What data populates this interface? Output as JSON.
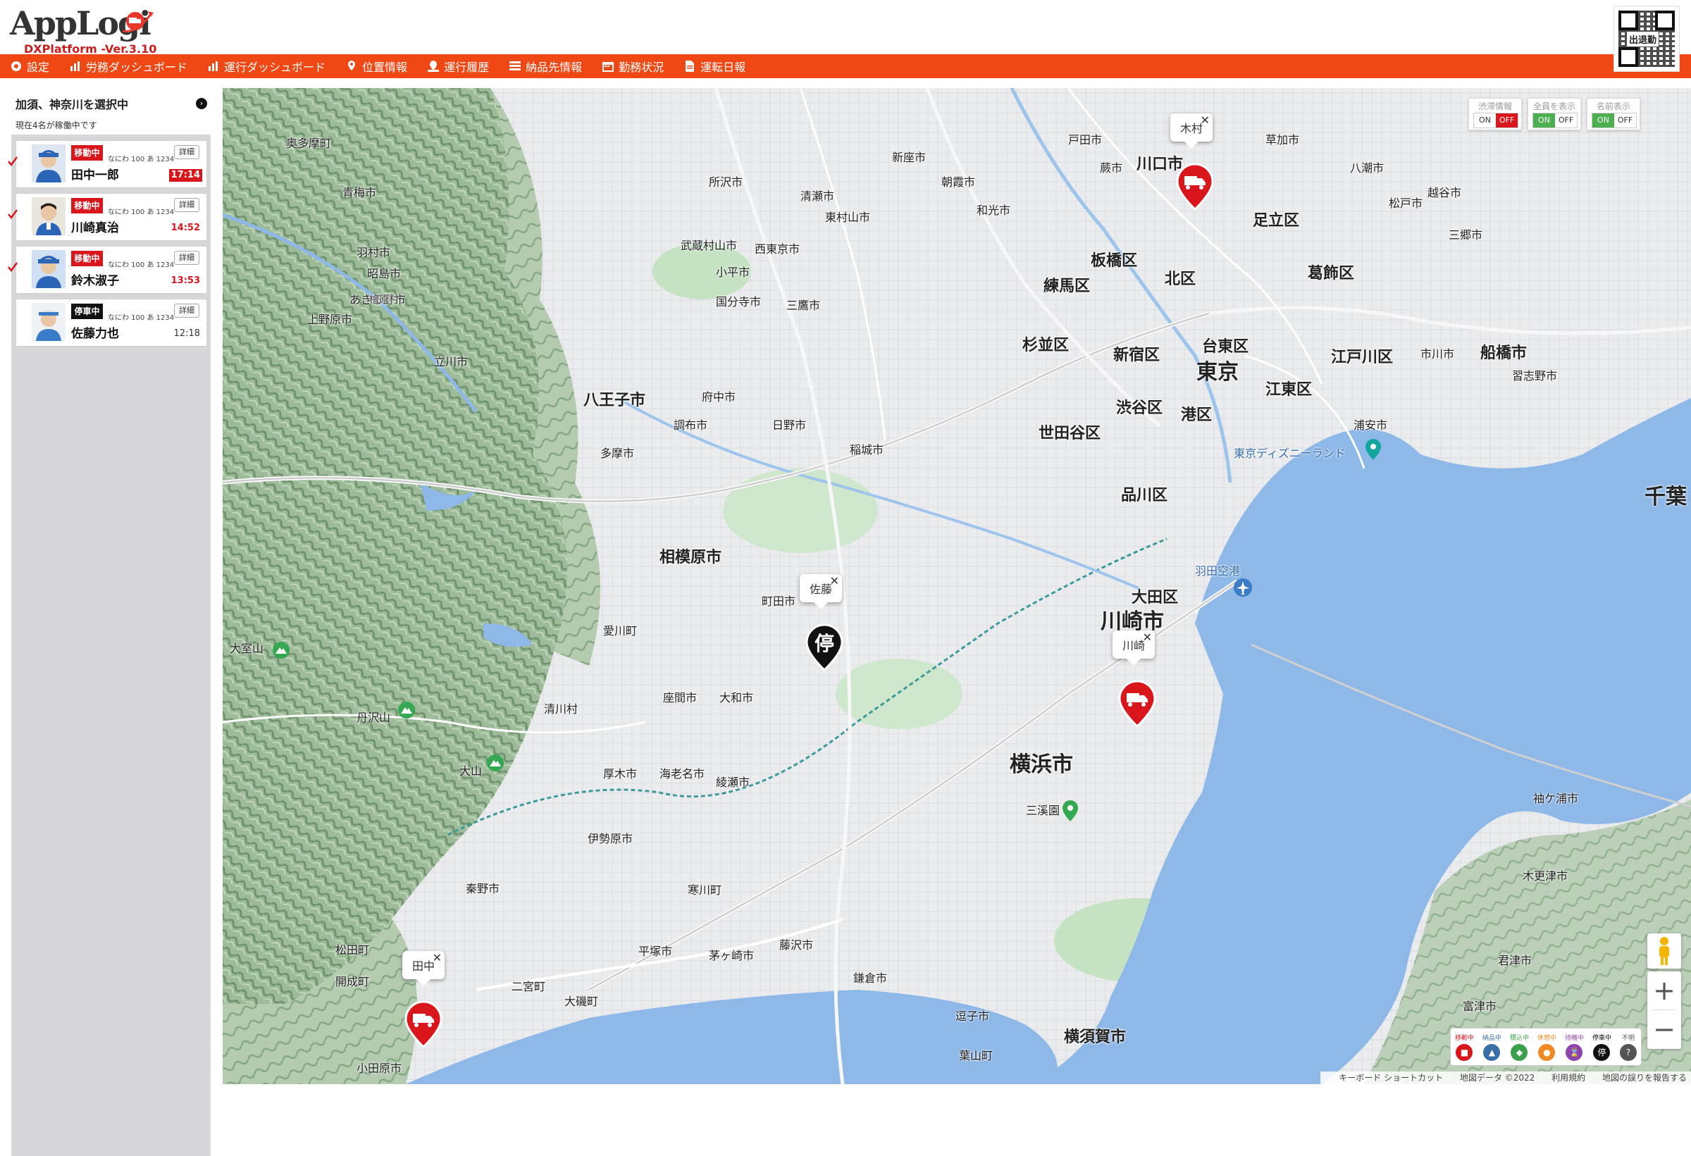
{
  "app": {
    "logo_text": "AppLogi",
    "logo_badge": "UP!",
    "version": "DXPlatform -Ver.3.10",
    "qr_label": "出退勤"
  },
  "nav": [
    {
      "label": "設定",
      "icon": "gear-icon"
    },
    {
      "label": "労務ダッシュボード",
      "icon": "bar-chart-icon"
    },
    {
      "label": "運行ダッシュボード",
      "icon": "bar-chart-icon"
    },
    {
      "label": "位置情報",
      "icon": "map-pin-icon"
    },
    {
      "label": "運行履歴",
      "icon": "route-history-icon"
    },
    {
      "label": "納品先情報",
      "icon": "list-icon"
    },
    {
      "label": "勤務状況",
      "icon": "calendar-icon"
    },
    {
      "label": "運転日報",
      "icon": "document-icon"
    }
  ],
  "sidebar": {
    "heading": "加須、神奈川を選択中",
    "subtitle": "現在4名が稼働中です",
    "detail_label": "詳細",
    "drivers": [
      {
        "status": "移動中",
        "status_color": "#d9161c",
        "plate": "なにわ 100 あ 1234",
        "name": "田中一郎",
        "time": "17:14",
        "time_alert": true
      },
      {
        "status": "移動中",
        "status_color": "#d9161c",
        "plate": "なにわ 100 あ 1234",
        "name": "川崎真治",
        "time": "14:52",
        "time_alert": false
      },
      {
        "status": "移動中",
        "status_color": "#d9161c",
        "plate": "なにわ 100 あ 1234",
        "name": "鈴木淑子",
        "time": "13:53",
        "time_alert": false
      },
      {
        "status": "停車中",
        "status_color": "#111111",
        "plate": "なにわ 100 あ 1234",
        "name": "佐藤力也",
        "time": "12:18",
        "time_alert": false
      }
    ]
  },
  "map": {
    "toggles": [
      {
        "label": "渋滞情報",
        "on": "ON",
        "off": "OFF",
        "active": "off"
      },
      {
        "label": "全員を表示",
        "on": "ON",
        "off": "OFF",
        "active": "on"
      },
      {
        "label": "名前表示",
        "on": "ON",
        "off": "OFF",
        "active": "on"
      }
    ],
    "markers": [
      {
        "name": "木村",
        "type": "truck"
      },
      {
        "name": "佐藤",
        "type": "stop",
        "glyph": "停"
      },
      {
        "name": "川崎",
        "type": "truck"
      },
      {
        "name": "田中",
        "type": "truck"
      }
    ],
    "close_glyph": "✕",
    "legend": [
      {
        "label": "移動中",
        "color": "#d9161c",
        "glyph": "🚚"
      },
      {
        "label": "納品中",
        "color": "#3a6ea8",
        "glyph": "⚑"
      },
      {
        "label": "積込中",
        "color": "#3aa04a",
        "glyph": "◆"
      },
      {
        "label": "休憩中",
        "color": "#f08a24",
        "glyph": "☕"
      },
      {
        "label": "待機中",
        "color": "#8e44ad",
        "glyph": "⌛"
      },
      {
        "label": "停車中",
        "color": "#111111",
        "glyph": "停"
      },
      {
        "label": "不明",
        "color": "#555555",
        "glyph": "?"
      }
    ],
    "zoom_in": "+",
    "zoom_out": "−",
    "attribution": [
      "キーボード ショートカット",
      "地図データ ©2022",
      "利用規約",
      "地図の誤りを報告する"
    ],
    "places": {
      "tokyo": "東京",
      "kawasaki": "川崎市",
      "yokohama": "横浜市",
      "chiba": "千葉",
      "sagamihara": "相模原市",
      "hachioji": "八王子市",
      "kawaguchi": "川口市",
      "adachi": "足立区",
      "itabashi": "板橋区",
      "kita": "北区",
      "katsushika": "葛飾区",
      "nerima": "練馬区",
      "suginami": "杉並区",
      "shinjuku": "新宿区",
      "taito": "台東区",
      "edogawa": "江戸川区",
      "koto": "江東区",
      "shibuya": "渋谷区",
      "minato": "港区",
      "setagaya": "世田谷区",
      "shinagawa": "品川区",
      "ota": "大田区",
      "funabashi": "船橋市",
      "yokosuka": "横須賀市",
      "haneda": "羽田空港",
      "disney": "東京ディズニーランド",
      "machida": "町田市",
      "yamato": "大和市",
      "atsugi": "厚木市",
      "fujisawa": "藤沢市",
      "hiratsuka": "平塚市",
      "chigasaki": "茅ヶ崎市",
      "odawara": "小田原市",
      "hadano": "秦野市",
      "isehara": "伊勢原市",
      "ebina": "海老名市",
      "ayase": "綾瀬市",
      "zama": "座間市",
      "kamakura": "鎌倉市",
      "zushi": "逗子市",
      "hayama": "葉山町",
      "tanzawa": "丹沢山",
      "oyama": "大山",
      "omuro": "大室山",
      "ome": "青梅市",
      "akishima": "昭島市",
      "tachikawa": "立川市",
      "fuchu": "府中市",
      "chofu": "調布市",
      "tama": "多摩市",
      "inagi": "稲城市",
      "mitaka": "三鷹市",
      "tokorozawa": "所沢市",
      "kisarazu": "木更津市",
      "ichikawa": "市川市",
      "urayasu": "浦安市",
      "sodegaura": "袖ケ浦市",
      "futtsu": "富津市",
      "kimitsu": "君津市",
      "matsudo": "松戸市",
      "kawaguchi2": "草加市",
      "sankeien": "三溪園",
      "aikawa": "愛川町",
      "kiyokawa": "清川村",
      "okutama": "奥多摩町",
      "hinohara": "檜原村",
      "uenohara": "上野原市",
      "kaisei": "開成町",
      "matsuda": "松田町",
      "ninomiya": "二宮町",
      "oiso": "大磯町",
      "samukawa": "寒川町",
      "hino": "日野市",
      "hamura": "羽村市",
      "musashimurayama": "武蔵村山市",
      "akiruno": "あきる野市",
      "kodaira": "小平市",
      "kokubunji": "国分寺市",
      "nishitokyo": "西東京市",
      "higashimurayama": "東村山市",
      "kiyose": "清瀬市",
      "niiza": "新座市",
      "asaka": "朝霞市",
      "wako": "和光市",
      "toda": "戸田市",
      "warabi": "蕨市",
      "yashio": "八潮市",
      "misato": "三郷市",
      "koshigaya": "越谷市",
      "ichikawa2": "市川市",
      "narashino": "習志野市",
      "sodegaura2": "袖ケ浦市"
    }
  }
}
